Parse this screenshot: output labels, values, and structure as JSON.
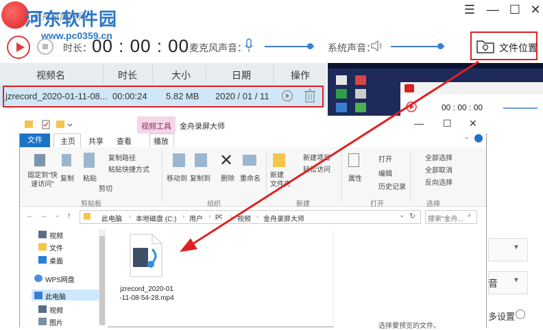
{
  "app": {
    "title": "金舟录屏大师",
    "watermark_name": "河东软件园",
    "watermark_url": "www.pc0359.cn",
    "controls": {
      "menu": "☰",
      "minimize": "—",
      "maximize": "☐",
      "close": "✕"
    }
  },
  "toolbar": {
    "duration_label": "时长：",
    "timer": "00 : 00 : 00",
    "mic_label": "麦克风声音：",
    "mic_level": 0.92,
    "system_label": "系统声音：",
    "system_level": 0.92,
    "folder_button": "文件位置"
  },
  "table": {
    "headers": [
      "视频名",
      "时长",
      "大小",
      "日期",
      "操作"
    ],
    "rows": [
      {
        "name": "jzrecord_2020-01-11-08...",
        "duration": "00:00:24",
        "size": "5.82 MB",
        "date": "2020 / 01 / 11"
      }
    ]
  },
  "explorer": {
    "tools_tab": "视频工具",
    "window_title": "金舟录屏大师",
    "tabs": [
      "文件",
      "主页",
      "共享",
      "查看",
      "播放"
    ],
    "ribbon": {
      "pin": "固定到\"快\n速访问\"",
      "copy": "复制",
      "paste": "粘贴",
      "copy_path": "复制路径",
      "paste_shortcut": "粘贴快捷方式",
      "cut": "剪切",
      "clipboard_group": "剪贴板",
      "move_to": "移动到",
      "copy_to": "复制到",
      "delete": "删除",
      "rename": "重命名",
      "organize_group": "组织",
      "new_folder": "新建\n文件夹",
      "new_item": "新建项目",
      "easy_access": "轻松访问",
      "new_group": "新建",
      "properties": "属性",
      "open": "打开",
      "edit": "编辑",
      "history": "历史记录",
      "open_group": "打开",
      "select_all": "全部选择",
      "select_none": "全部取消",
      "invert_selection": "反向选择",
      "select_group": "选择"
    },
    "address": [
      "此电脑",
      "本地磁盘 (C:)",
      "用户",
      "pc",
      "视频",
      "金舟录屏大师"
    ],
    "search_placeholder": "搜索\"金舟...",
    "nav": [
      "视频",
      "文件",
      "桌面",
      "WPS网盘",
      "此电脑",
      "视频",
      "图片"
    ],
    "file_name": "jzrecord_2020-01-11-08-54-28.mp4",
    "preview_hint": "选择要预览的文件。"
  },
  "right_panel": {
    "sound_label": "音",
    "more_settings": "多设置"
  },
  "colors": {
    "accent": "#3a7ed1",
    "highlight": "#e02020",
    "row_selected": "#cfe7f7",
    "file_tab": "#1a73c8"
  }
}
